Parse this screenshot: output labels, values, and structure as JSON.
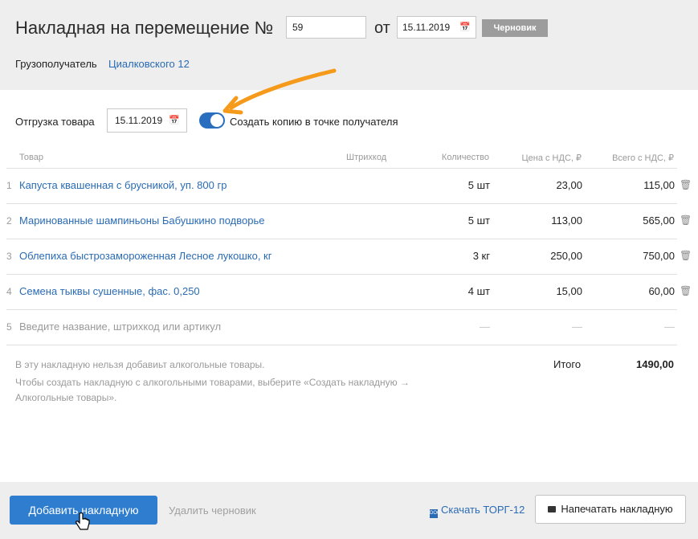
{
  "header": {
    "title": "Накладная на перемещение №",
    "number": "59",
    "from_word": "от",
    "date": "15.11.2019",
    "status": "Черновик",
    "consignee_label": "Грузополучатель",
    "consignee_value": "Циалковского 12"
  },
  "shipment": {
    "label": "Отгрузка товара",
    "date": "15.11.2019",
    "copy_toggle_label": "Создать копию в точке получателя",
    "copy_toggle_on": true
  },
  "table": {
    "headers": [
      "Товар",
      "Штрихкод",
      "Количество",
      "Цена с НДС, ₽",
      "Всего с НДС, ₽"
    ],
    "rows": [
      {
        "n": "1",
        "name": "Капуста квашенная с брусникой, уп. 800 гр",
        "qty": "5 шт",
        "price": "23,00",
        "total": "115,00"
      },
      {
        "n": "2",
        "name": "Маринованные шампиньоны Бабушкино подворье",
        "qty": "5 шт",
        "price": "113,00",
        "total": "565,00"
      },
      {
        "n": "3",
        "name": "Облепиха быстрозамороженная Лесное лукошко, кг",
        "qty": "3 кг",
        "price": "250,00",
        "total": "750,00"
      },
      {
        "n": "4",
        "name": "Семена тыквы сушенные, фас. 0,250",
        "qty": "4 шт",
        "price": "15,00",
        "total": "60,00"
      }
    ],
    "new_row": {
      "n": "5",
      "placeholder": "Введите название, штрихкод или артикул",
      "dash": "—"
    }
  },
  "notes": {
    "line1": "В эту накладную нельзя добавиьт алкогольные товары.",
    "line2": "Чтобы создать накладную с алкогольными товарами, выберите «Создать накладную →",
    "line3": "Алкогольные товары»."
  },
  "totals": {
    "label": "Итого",
    "value": "1490,00"
  },
  "footer": {
    "add_button": "Добавить накладную",
    "delete_draft": "Удалить черновик",
    "download_torg": "Скачать ТОРГ-12",
    "print_button": "Напечатать накладную"
  },
  "colors": {
    "accent": "#2f7dcf",
    "link": "#2a6bb5",
    "arrow": "#f59a1b",
    "badge": "#9c9c9c"
  }
}
